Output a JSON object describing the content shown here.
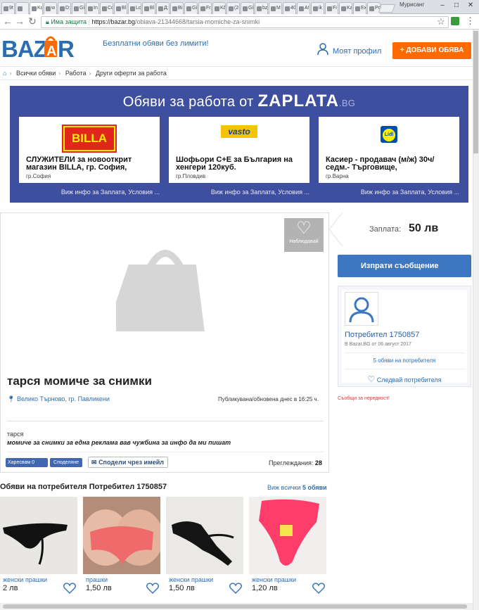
{
  "browser": {
    "tabs": [
      "9t",
      "",
      "Kc",
      "w",
      "D:",
      "Gi",
      "In",
      "Cc",
      "Bl",
      "Lc",
      "Bl",
      "Д:",
      "Bi",
      "Gi",
      "Fr",
      "Kč",
      "(2",
      "Gi",
      "bz",
      "M",
      "40",
      "A!",
      "ik",
      "Fi",
      "Ka",
      "Ex",
      "Pc"
    ],
    "active_tab_index": 2,
    "profile_name": "Мурисанг",
    "secure_label": "Има защита",
    "url_host": "https://bazar.bg",
    "url_path": "/obiava-21344668/tarsia-momiche-za-snimki"
  },
  "site": {
    "logo_text": "BAZAR",
    "tagline": "Безплатни обяви без лимити!",
    "profile_link": "Моят профил",
    "add_button": "+ ДОБАВИ ОБЯВА"
  },
  "breadcrumb": [
    "Всички обяви",
    "Работа",
    "Други оферти за работа"
  ],
  "banner": {
    "title_prefix": "Обяви за работа от",
    "brand": "ZAPLATA",
    "brand_suffix": ".BG",
    "jobs": [
      {
        "logo": "BILLA",
        "title": "СЛУЖИТЕЛИ за новооткрит магазин BILLA, гр. София,",
        "location": "гр.София",
        "more": "Виж инфо за Заплата, Условия ..."
      },
      {
        "logo": "vasto",
        "title": "Шофьори С+Е за България на хенгери 120куб.",
        "location": "гр.Пловдив",
        "more": "Виж инфо за Заплата, Условия ..."
      },
      {
        "logo": "Lidl",
        "title": "Касиер - продавач (м/ж) 30ч/седм.- Търговище,",
        "location": "гр.Варна",
        "more": "Виж инфо за Заплата, Условия ..."
      }
    ]
  },
  "ad": {
    "watch_label": "Наблюдавай",
    "title": "тарся момиче за снимки",
    "location": "Велико Търново, гр. Павликени",
    "published": "Публикувана/обновена днес в 16:25 ч.",
    "desc_label": "тарся",
    "description": "момиче за снимки за една реклама вав чужбина за инфо да ми пишат",
    "fb_like": "Харесвам 0",
    "fb_share": "Споделяне",
    "email_share": "Сподели чрез имейл",
    "views_label": "Преглеждания:",
    "views": "28"
  },
  "sidebar": {
    "price_label": "Заплата:",
    "price_value": "50 лв",
    "message_button": "Изпрати съобщение",
    "user_name": "Потребител 1750857",
    "user_since": "В Bazar.BG от 06 август 2017",
    "user_ads": "5 обяви на потребителя",
    "follow": "Следвай потребителя",
    "report": "Съобщи за нередност!"
  },
  "user_ads": {
    "title": "Обяви на потребителя Потребител 1750857",
    "view_all_prefix": "Виж всички",
    "view_all_count": "5 обяви",
    "items": [
      {
        "category": "женски прашки",
        "price": "2 лв"
      },
      {
        "category": "прашки",
        "price": "1,50 лв"
      },
      {
        "category": "женски прашки",
        "price": "1,50 лв"
      },
      {
        "category": "женски прашки",
        "price": "1,20 лв"
      }
    ]
  },
  "colors": {
    "brand_blue": "#3d77c1",
    "brand_orange": "#ff6a00",
    "banner": "#3f4fa0"
  }
}
